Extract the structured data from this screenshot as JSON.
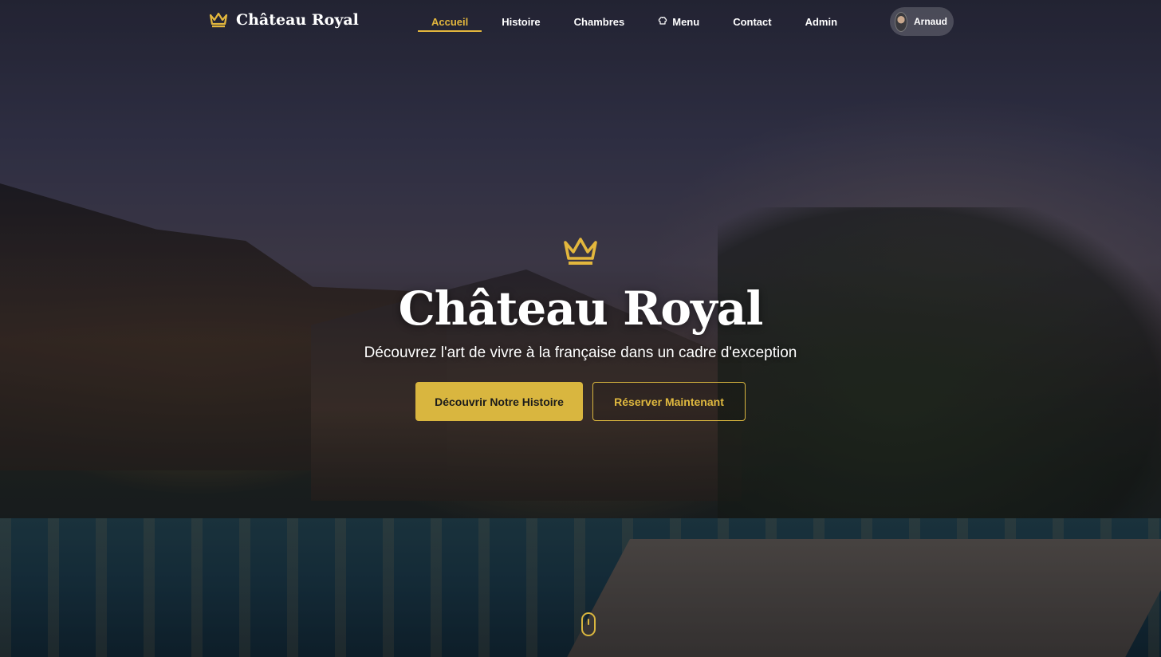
{
  "brand": {
    "name": "Château Royal",
    "icon": "crown-icon"
  },
  "nav": {
    "items": [
      {
        "label": "Accueil",
        "active": true
      },
      {
        "label": "Histoire",
        "active": false
      },
      {
        "label": "Chambres",
        "active": false
      },
      {
        "label": "Menu",
        "active": false,
        "icon": "hat-icon"
      },
      {
        "label": "Contact",
        "active": false
      },
      {
        "label": "Admin",
        "active": false
      }
    ]
  },
  "user": {
    "name": "Arnaud"
  },
  "hero": {
    "icon": "crown-icon",
    "title": "Château Royal",
    "subtitle": "Découvrez l'art de vivre à la française dans un cadre d'exception",
    "primary_label": "Découvrir Notre Histoire",
    "secondary_label": "Réserver Maintenant"
  },
  "scroll": {
    "icon": "mouse-scroll-icon"
  },
  "colors": {
    "accent": "#d9b63f",
    "active_nav": "#e3b73d",
    "text": "#ffffff"
  }
}
